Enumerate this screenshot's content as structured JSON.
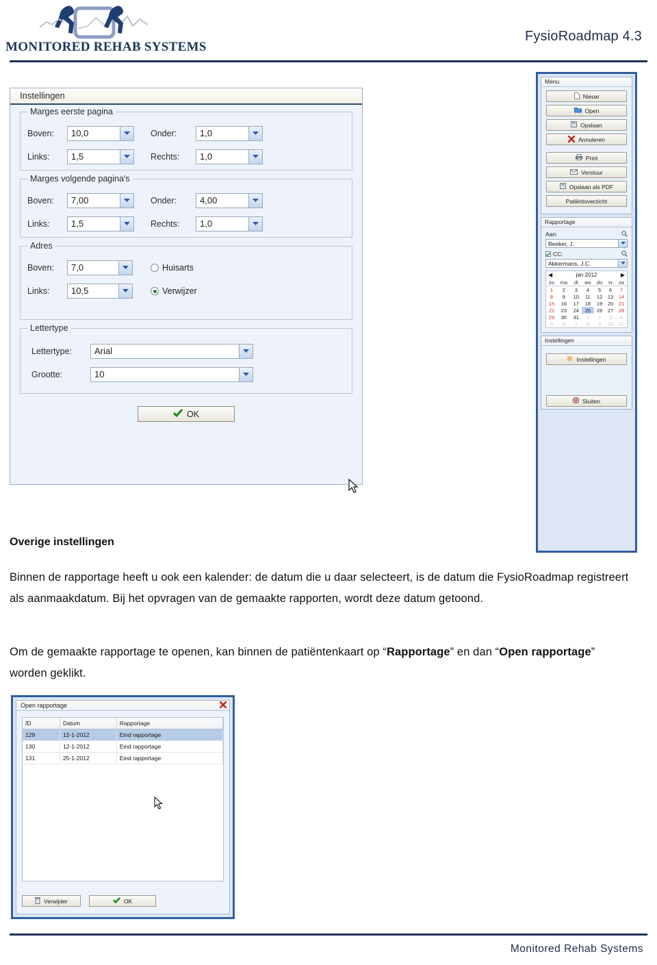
{
  "header": {
    "logo_text": "MONITORED REHAB SYSTEMS",
    "doc_title": "FysioRoadmap 4.3"
  },
  "settings_dialog": {
    "title": "Instellingen",
    "groups": [
      {
        "legend": "Marges eerste pagina",
        "fields": [
          {
            "label": "Boven:",
            "value": "10,0"
          },
          {
            "label": "Onder:",
            "value": "1,0"
          },
          {
            "label": "Links:",
            "value": "1,5"
          },
          {
            "label": "Rechts:",
            "value": "1,0"
          }
        ]
      },
      {
        "legend": "Marges volgende pagina's",
        "fields": [
          {
            "label": "Boven:",
            "value": "7,00"
          },
          {
            "label": "Onder:",
            "value": "4,00"
          },
          {
            "label": "Links:",
            "value": "1,5"
          },
          {
            "label": "Rechts:",
            "value": "1,0"
          }
        ]
      },
      {
        "legend": "Adres",
        "fields": [
          {
            "label": "Boven:",
            "value": "7,0"
          },
          {
            "label": "Links:",
            "value": "10,5"
          }
        ],
        "radios": [
          {
            "label": "Huisarts",
            "selected": false
          },
          {
            "label": "Verwijzer",
            "selected": true
          }
        ]
      },
      {
        "legend": "Lettertype",
        "fields": [
          {
            "label": "Lettertype:",
            "value": "Arial"
          },
          {
            "label": "Grootte:",
            "value": "10"
          }
        ]
      }
    ],
    "ok_label": "OK"
  },
  "right_panel": {
    "menu": {
      "title": "Menu",
      "buttons": [
        {
          "label": "Nieuw",
          "icon": "document-icon"
        },
        {
          "label": "Open",
          "icon": "folder-icon"
        },
        {
          "label": "Opslaan",
          "icon": "floppy-disk-icon"
        },
        {
          "label": "Annuleren",
          "icon": "red-cross-icon"
        },
        {
          "label": "Print",
          "icon": "printer-icon"
        },
        {
          "label": "Verstuur",
          "icon": "envelope-icon"
        },
        {
          "label": "Opslaan als PDF",
          "icon": "floppy-disk-icon"
        },
        {
          "label": "Patiëntoverzicht",
          "icon": "none"
        }
      ]
    },
    "rapportage": {
      "title": "Rapportage",
      "aan_label": "Aan:",
      "aan_value": "Beeker, J.",
      "cc_label": "CC:",
      "cc_checked": true,
      "cc_value": "Akkermans, J.C.",
      "calendar": {
        "month_label": "jan 2012",
        "prev_icon": "left-triangle-icon",
        "next_icon": "right-triangle-icon",
        "weekdays": [
          "zo",
          "ma",
          "di",
          "wo",
          "do",
          "vr",
          "za"
        ],
        "selected_day": 25,
        "weeks": [
          [
            {
              "d": 1,
              "o": false
            },
            {
              "d": 2,
              "o": false
            },
            {
              "d": 3,
              "o": false
            },
            {
              "d": 4,
              "o": false
            },
            {
              "d": 5,
              "o": false
            },
            {
              "d": 6,
              "o": false
            },
            {
              "d": 7,
              "o": false
            }
          ],
          [
            {
              "d": 8,
              "o": false
            },
            {
              "d": 9,
              "o": false
            },
            {
              "d": 10,
              "o": false
            },
            {
              "d": 11,
              "o": false
            },
            {
              "d": 12,
              "o": false
            },
            {
              "d": 13,
              "o": false
            },
            {
              "d": 14,
              "o": false
            }
          ],
          [
            {
              "d": 15,
              "o": false
            },
            {
              "d": 16,
              "o": false
            },
            {
              "d": 17,
              "o": false
            },
            {
              "d": 18,
              "o": false
            },
            {
              "d": 19,
              "o": false
            },
            {
              "d": 20,
              "o": false
            },
            {
              "d": 21,
              "o": false
            }
          ],
          [
            {
              "d": 22,
              "o": false
            },
            {
              "d": 23,
              "o": false
            },
            {
              "d": 24,
              "o": false
            },
            {
              "d": 25,
              "o": false
            },
            {
              "d": 26,
              "o": false
            },
            {
              "d": 27,
              "o": false
            },
            {
              "d": 28,
              "o": false
            }
          ],
          [
            {
              "d": 29,
              "o": false
            },
            {
              "d": 30,
              "o": false
            },
            {
              "d": 31,
              "o": false
            },
            {
              "d": 1,
              "o": true
            },
            {
              "d": 2,
              "o": true
            },
            {
              "d": 3,
              "o": true
            },
            {
              "d": 4,
              "o": true
            }
          ],
          [
            {
              "d": 5,
              "o": true
            },
            {
              "d": 6,
              "o": true
            },
            {
              "d": 7,
              "o": true
            },
            {
              "d": 8,
              "o": true
            },
            {
              "d": 9,
              "o": true
            },
            {
              "d": 10,
              "o": true
            },
            {
              "d": 11,
              "o": true
            }
          ]
        ]
      }
    },
    "instellingen": {
      "title": "Instellingen",
      "settings_label": "Instellingen",
      "close_label": "Sluiten"
    }
  },
  "content": {
    "heading": "Overige instellingen",
    "paragraph1": "Binnen de rapportage heeft u ook een kalender: de datum die u daar selecteert, is de datum die FysioRoadmap registreert als aanmaakdatum. Bij het opvragen van de gemaakte rapporten, wordt deze datum getoond.",
    "paragraph2_a": "Om de gemaakte rapportage te openen, kan binnen de patiëntenkaart op “",
    "paragraph2_b": "Rapportage",
    "paragraph2_c": "” en dan “",
    "paragraph2_d": "Open rapportage",
    "paragraph2_e": "” worden geklikt."
  },
  "open_rapportage_dialog": {
    "title": "Open rapportage",
    "close_icon": "red-cross-icon",
    "columns": [
      "ID",
      "Datum",
      "Rapportage"
    ],
    "rows": [
      {
        "id": "129",
        "datum": "12-1-2012",
        "rapportage": "Eind rapportage",
        "selected": true
      },
      {
        "id": "130",
        "datum": "12-1-2012",
        "rapportage": "Eind rapportage",
        "selected": false
      },
      {
        "id": "131",
        "datum": "25-1-2012",
        "rapportage": "Eind rapportage",
        "selected": false
      }
    ],
    "delete_label": "Verwijder",
    "ok_label": "OK"
  },
  "footer": {
    "text": "Monitored Rehab Systems"
  },
  "colors": {
    "brand_navy": "#1f3158",
    "panel_blue_border": "#2f5f9e",
    "dialog_bg": "#eef3fb",
    "selection_blue": "#b6cbe6",
    "weekend_red": "#c0392b"
  }
}
